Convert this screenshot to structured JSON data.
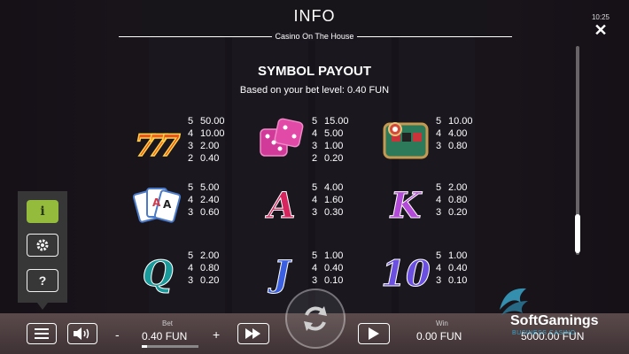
{
  "header": {
    "title": "INFO",
    "subtitle": "Casino On The House",
    "time": "10:25"
  },
  "payout": {
    "title": "SYMBOL PAYOUT",
    "subtitle": "Based on your bet level: 0.40 FUN",
    "symbols": [
      {
        "icon": "triple-seven-icon",
        "pays": [
          [
            "5",
            "50.00"
          ],
          [
            "4",
            "10.00"
          ],
          [
            "3",
            "2.00"
          ],
          [
            "2",
            "0.40"
          ]
        ]
      },
      {
        "icon": "dice-icon",
        "pays": [
          [
            "5",
            "15.00"
          ],
          [
            "4",
            "5.00"
          ],
          [
            "3",
            "1.00"
          ],
          [
            "2",
            "0.20"
          ]
        ]
      },
      {
        "icon": "roulette-table-icon",
        "pays": [
          [
            "5",
            "10.00"
          ],
          [
            "4",
            "4.00"
          ],
          [
            "3",
            "0.80"
          ]
        ]
      },
      {
        "icon": "playing-cards-icon",
        "pays": [
          [
            "5",
            "5.00"
          ],
          [
            "4",
            "2.40"
          ],
          [
            "3",
            "0.60"
          ]
        ]
      },
      {
        "icon": "letter-a-icon",
        "glyph": "A",
        "pays": [
          [
            "5",
            "4.00"
          ],
          [
            "4",
            "1.60"
          ],
          [
            "3",
            "0.30"
          ]
        ]
      },
      {
        "icon": "letter-k-icon",
        "glyph": "K",
        "pays": [
          [
            "5",
            "2.00"
          ],
          [
            "4",
            "0.80"
          ],
          [
            "3",
            "0.20"
          ]
        ]
      },
      {
        "icon": "letter-q-icon",
        "glyph": "Q",
        "pays": [
          [
            "5",
            "2.00"
          ],
          [
            "4",
            "0.80"
          ],
          [
            "3",
            "0.20"
          ]
        ]
      },
      {
        "icon": "letter-j-icon",
        "glyph": "J",
        "pays": [
          [
            "5",
            "1.00"
          ],
          [
            "4",
            "0.40"
          ],
          [
            "3",
            "0.10"
          ]
        ]
      },
      {
        "icon": "number-ten-icon",
        "glyph": "10",
        "pays": [
          [
            "5",
            "1.00"
          ],
          [
            "4",
            "0.40"
          ],
          [
            "3",
            "0.10"
          ]
        ]
      }
    ]
  },
  "side_menu": {
    "info_glyph": "i",
    "help_glyph": "?"
  },
  "bottom_bar": {
    "bet_label": "Bet",
    "bet_value": "0.40 FUN",
    "minus": "-",
    "plus": "+",
    "win_label": "Win",
    "win_value": "0.00 FUN",
    "balance_value": "5000.00 FUN"
  },
  "brand": {
    "name": "SoftGamings",
    "tagline": "BUSINESS CASINO"
  },
  "colors": {
    "info_active": "#9bc53d",
    "brand_teal": "#3aa4c9",
    "letter_a": "#d6245e",
    "letter_k": "#b34ad8",
    "letter_q": "#1a9a9a",
    "letter_j": "#3a5fe0",
    "number_ten": "#6a4fe0"
  }
}
